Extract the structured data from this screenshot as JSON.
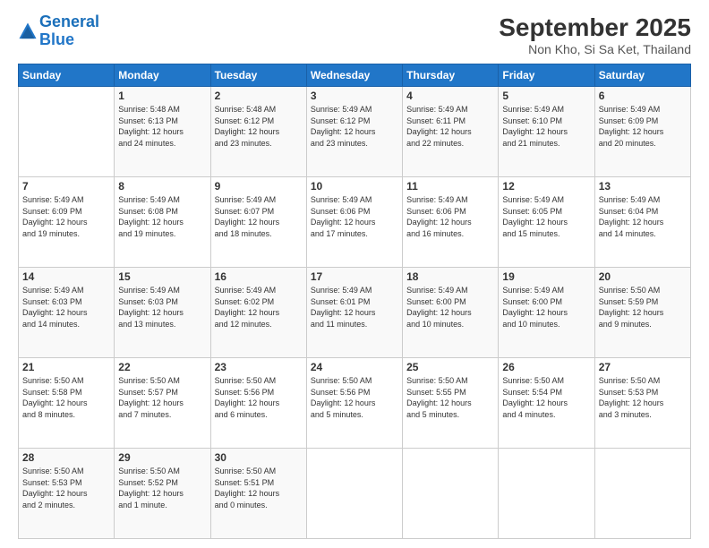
{
  "header": {
    "logo_line1": "General",
    "logo_line2": "Blue",
    "month": "September 2025",
    "location": "Non Kho, Si Sa Ket, Thailand"
  },
  "days_of_week": [
    "Sunday",
    "Monday",
    "Tuesday",
    "Wednesday",
    "Thursday",
    "Friday",
    "Saturday"
  ],
  "weeks": [
    [
      {
        "day": "",
        "info": ""
      },
      {
        "day": "1",
        "info": "Sunrise: 5:48 AM\nSunset: 6:13 PM\nDaylight: 12 hours\nand 24 minutes."
      },
      {
        "day": "2",
        "info": "Sunrise: 5:48 AM\nSunset: 6:12 PM\nDaylight: 12 hours\nand 23 minutes."
      },
      {
        "day": "3",
        "info": "Sunrise: 5:49 AM\nSunset: 6:12 PM\nDaylight: 12 hours\nand 23 minutes."
      },
      {
        "day": "4",
        "info": "Sunrise: 5:49 AM\nSunset: 6:11 PM\nDaylight: 12 hours\nand 22 minutes."
      },
      {
        "day": "5",
        "info": "Sunrise: 5:49 AM\nSunset: 6:10 PM\nDaylight: 12 hours\nand 21 minutes."
      },
      {
        "day": "6",
        "info": "Sunrise: 5:49 AM\nSunset: 6:09 PM\nDaylight: 12 hours\nand 20 minutes."
      }
    ],
    [
      {
        "day": "7",
        "info": "Sunrise: 5:49 AM\nSunset: 6:09 PM\nDaylight: 12 hours\nand 19 minutes."
      },
      {
        "day": "8",
        "info": "Sunrise: 5:49 AM\nSunset: 6:08 PM\nDaylight: 12 hours\nand 19 minutes."
      },
      {
        "day": "9",
        "info": "Sunrise: 5:49 AM\nSunset: 6:07 PM\nDaylight: 12 hours\nand 18 minutes."
      },
      {
        "day": "10",
        "info": "Sunrise: 5:49 AM\nSunset: 6:06 PM\nDaylight: 12 hours\nand 17 minutes."
      },
      {
        "day": "11",
        "info": "Sunrise: 5:49 AM\nSunset: 6:06 PM\nDaylight: 12 hours\nand 16 minutes."
      },
      {
        "day": "12",
        "info": "Sunrise: 5:49 AM\nSunset: 6:05 PM\nDaylight: 12 hours\nand 15 minutes."
      },
      {
        "day": "13",
        "info": "Sunrise: 5:49 AM\nSunset: 6:04 PM\nDaylight: 12 hours\nand 14 minutes."
      }
    ],
    [
      {
        "day": "14",
        "info": "Sunrise: 5:49 AM\nSunset: 6:03 PM\nDaylight: 12 hours\nand 14 minutes."
      },
      {
        "day": "15",
        "info": "Sunrise: 5:49 AM\nSunset: 6:03 PM\nDaylight: 12 hours\nand 13 minutes."
      },
      {
        "day": "16",
        "info": "Sunrise: 5:49 AM\nSunset: 6:02 PM\nDaylight: 12 hours\nand 12 minutes."
      },
      {
        "day": "17",
        "info": "Sunrise: 5:49 AM\nSunset: 6:01 PM\nDaylight: 12 hours\nand 11 minutes."
      },
      {
        "day": "18",
        "info": "Sunrise: 5:49 AM\nSunset: 6:00 PM\nDaylight: 12 hours\nand 10 minutes."
      },
      {
        "day": "19",
        "info": "Sunrise: 5:49 AM\nSunset: 6:00 PM\nDaylight: 12 hours\nand 10 minutes."
      },
      {
        "day": "20",
        "info": "Sunrise: 5:50 AM\nSunset: 5:59 PM\nDaylight: 12 hours\nand 9 minutes."
      }
    ],
    [
      {
        "day": "21",
        "info": "Sunrise: 5:50 AM\nSunset: 5:58 PM\nDaylight: 12 hours\nand 8 minutes."
      },
      {
        "day": "22",
        "info": "Sunrise: 5:50 AM\nSunset: 5:57 PM\nDaylight: 12 hours\nand 7 minutes."
      },
      {
        "day": "23",
        "info": "Sunrise: 5:50 AM\nSunset: 5:56 PM\nDaylight: 12 hours\nand 6 minutes."
      },
      {
        "day": "24",
        "info": "Sunrise: 5:50 AM\nSunset: 5:56 PM\nDaylight: 12 hours\nand 5 minutes."
      },
      {
        "day": "25",
        "info": "Sunrise: 5:50 AM\nSunset: 5:55 PM\nDaylight: 12 hours\nand 5 minutes."
      },
      {
        "day": "26",
        "info": "Sunrise: 5:50 AM\nSunset: 5:54 PM\nDaylight: 12 hours\nand 4 minutes."
      },
      {
        "day": "27",
        "info": "Sunrise: 5:50 AM\nSunset: 5:53 PM\nDaylight: 12 hours\nand 3 minutes."
      }
    ],
    [
      {
        "day": "28",
        "info": "Sunrise: 5:50 AM\nSunset: 5:53 PM\nDaylight: 12 hours\nand 2 minutes."
      },
      {
        "day": "29",
        "info": "Sunrise: 5:50 AM\nSunset: 5:52 PM\nDaylight: 12 hours\nand 1 minute."
      },
      {
        "day": "30",
        "info": "Sunrise: 5:50 AM\nSunset: 5:51 PM\nDaylight: 12 hours\nand 0 minutes."
      },
      {
        "day": "",
        "info": ""
      },
      {
        "day": "",
        "info": ""
      },
      {
        "day": "",
        "info": ""
      },
      {
        "day": "",
        "info": ""
      }
    ]
  ]
}
